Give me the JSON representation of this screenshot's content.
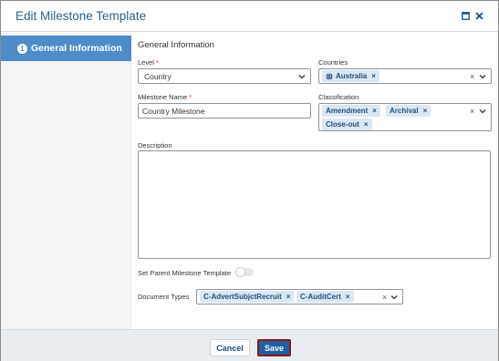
{
  "dialog": {
    "title": "Edit Milestone Template"
  },
  "sidebar": {
    "items": [
      {
        "number": "1",
        "label": "General Information"
      }
    ]
  },
  "form": {
    "section_title": "General Information",
    "level": {
      "label": "Level",
      "required": "*",
      "value": "Country"
    },
    "countries": {
      "label": "Countries",
      "tags": [
        "Australia"
      ]
    },
    "milestone_name": {
      "label": "Milestone Name",
      "required": "*",
      "value": "Country Milestone"
    },
    "classification": {
      "label": "Classification",
      "tags": [
        "Amendment",
        "Archival",
        "Close-out"
      ]
    },
    "description": {
      "label": "Description",
      "value": ""
    },
    "set_parent": {
      "label": "Set Parent Milestone Template",
      "enabled": false
    },
    "document_types": {
      "label": "Document Types",
      "tags": [
        "C-AdvertSubjctRecruit",
        "C-AuditCert"
      ]
    }
  },
  "icons": {
    "maximize": "maximize-icon",
    "close": "close-icon",
    "remove": "×",
    "clear": "×",
    "dropdown": "chevron-down-icon",
    "globe": "globe-icon"
  },
  "footer": {
    "cancel_label": "Cancel",
    "save_label": "Save"
  },
  "colors": {
    "accent": "#4e8cc9",
    "title": "#2b5f8e",
    "primary_button": "#1f5f9f",
    "tag_bg": "#dbe7f3",
    "required": "#d9261c"
  }
}
